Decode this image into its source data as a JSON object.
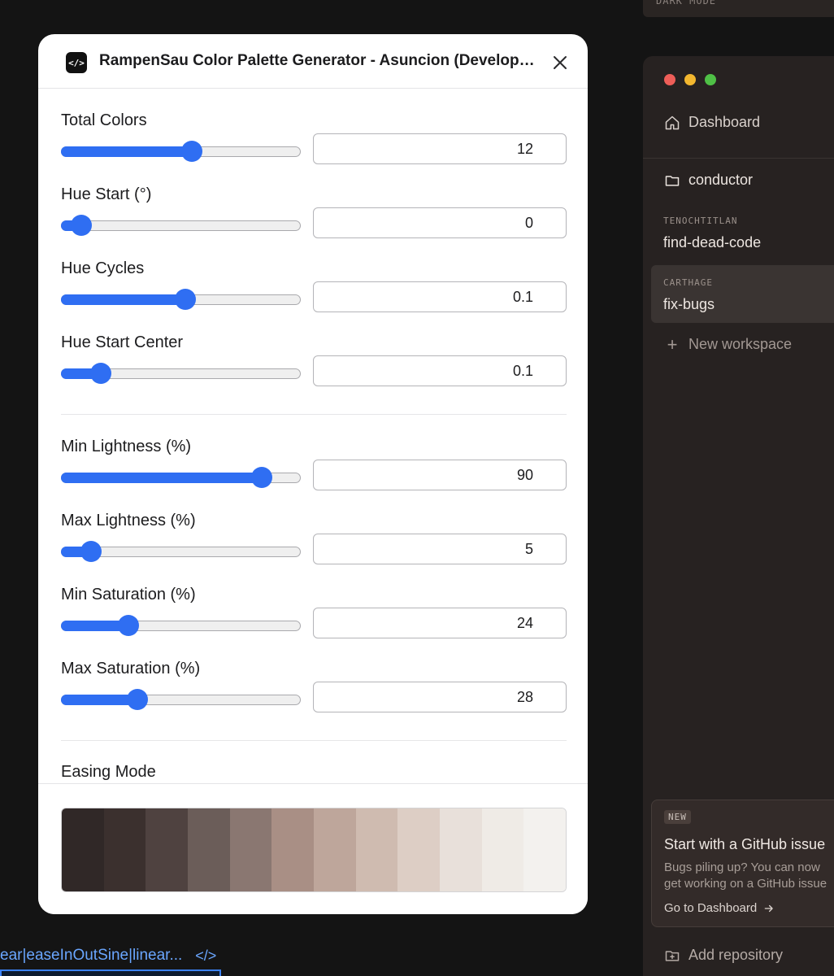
{
  "background": {
    "code_text": "ear|easeInOutSine|linear...",
    "code_icon": "code-icon"
  },
  "app": {
    "top_strip_label": "DARK MODE",
    "nav": {
      "dashboard": "Dashboard",
      "repo": "conductor"
    },
    "workspaces": [
      {
        "label": "TENOCHTITLAN",
        "name": "find-dead-code"
      },
      {
        "label": "CARTHAGE",
        "name": "fix-bugs"
      }
    ],
    "new_workspace": "New workspace",
    "card": {
      "badge": "NEW",
      "title": "Start with a GitHub issue",
      "desc_line1": "Bugs piling up? You can now",
      "desc_line2": "get working on a GitHub issue",
      "link": "Go to Dashboard"
    },
    "add_repository": "Add repository"
  },
  "dialog": {
    "title": "RampenSau Color Palette Generator - Asuncion (Developer Tools)",
    "params": [
      {
        "label": "Total Colors",
        "value": "12",
        "fraction": 0.55
      },
      {
        "label": "Hue Start (°)",
        "value": "0",
        "fraction": 0.045
      },
      {
        "label": "Hue Cycles",
        "value": "0.1",
        "fraction": 0.52
      },
      {
        "label": "Hue Start Center",
        "value": "0.1",
        "fraction": 0.135
      },
      {
        "label": "Min Lightness (%)",
        "value": "90",
        "fraction": 0.87
      },
      {
        "label": "Max Lightness (%)",
        "value": "5",
        "fraction": 0.09
      },
      {
        "label": "Min Saturation (%)",
        "value": "24",
        "fraction": 0.26
      },
      {
        "label": "Max Saturation (%)",
        "value": "28",
        "fraction": 0.3
      }
    ],
    "easing_label": "Easing Mode",
    "palette": [
      "#302827",
      "#3b302e",
      "#4f4240",
      "#6b5d59",
      "#8a7771",
      "#a98f85",
      "#bea69b",
      "#cfbbb0",
      "#ddcec5",
      "#e8e0da",
      "#efebe6",
      "#f3f1ee"
    ]
  }
}
